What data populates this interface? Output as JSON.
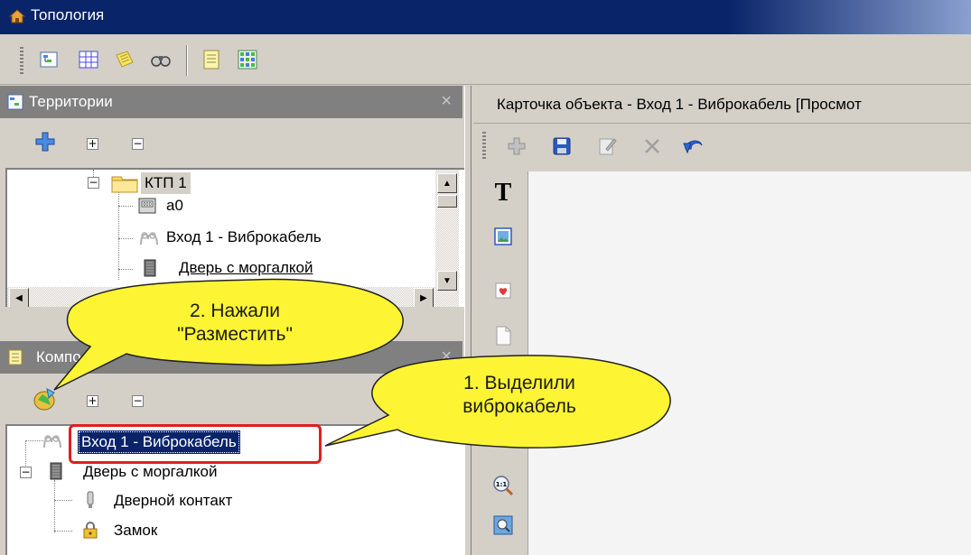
{
  "window": {
    "title": "Топология"
  },
  "main_toolbar": {
    "buttons": [
      "territories-icon",
      "table-icon",
      "notes-icon",
      "binoculars-icon",
      "list-icon",
      "grid-icon"
    ]
  },
  "territories_pane": {
    "title": "Территории",
    "close": "×",
    "expand": "+",
    "collapse": "−",
    "tree": [
      {
        "label": "КТП 1",
        "icon": "folder-icon",
        "expander": "−"
      },
      {
        "label": "а0",
        "icon": "device-icon"
      },
      {
        "label": "Вход 1 - Виброкабель",
        "icon": "vibro-cable-icon"
      },
      {
        "label": "Дверь с моргалкой",
        "icon": "door-icon"
      }
    ]
  },
  "components_pane": {
    "title": "Компо",
    "close": "×",
    "expand": "+",
    "collapse": "−",
    "tree": [
      {
        "label": "Вход 1 - Виброкабель",
        "icon": "vibro-cable-icon",
        "selected": true
      },
      {
        "label": "Дверь с моргалкой",
        "icon": "door-icon",
        "expander": "−"
      },
      {
        "label": "Дверной контакт",
        "icon": "door-contact-icon"
      },
      {
        "label": "Замок",
        "icon": "lock-icon"
      }
    ]
  },
  "card_pane": {
    "title": "Карточка объекта - Вход 1 - Виброкабель [Просмот",
    "toolbar": [
      "add-icon",
      "save-icon",
      "edit-icon",
      "delete-icon",
      "undo-icon"
    ],
    "side_tools": [
      "text-tool-icon",
      "image-tool-icon",
      "marker-tool-icon",
      "blank-page-icon",
      "zoom-1to1-icon",
      "zoom-fit-icon"
    ],
    "text_tool_glyph": "T",
    "zoom_glyph": "1:1"
  },
  "callouts": {
    "step1": "1. Выделили\nвиброкабель",
    "step2": "2. Нажали\n\"Разместить\""
  },
  "colors": {
    "title_bar": "#0a246a",
    "pane_title": "#808080",
    "callout_fill": "#fdf533",
    "highlight_border": "#e01e1e",
    "selection": "#0a246a"
  }
}
